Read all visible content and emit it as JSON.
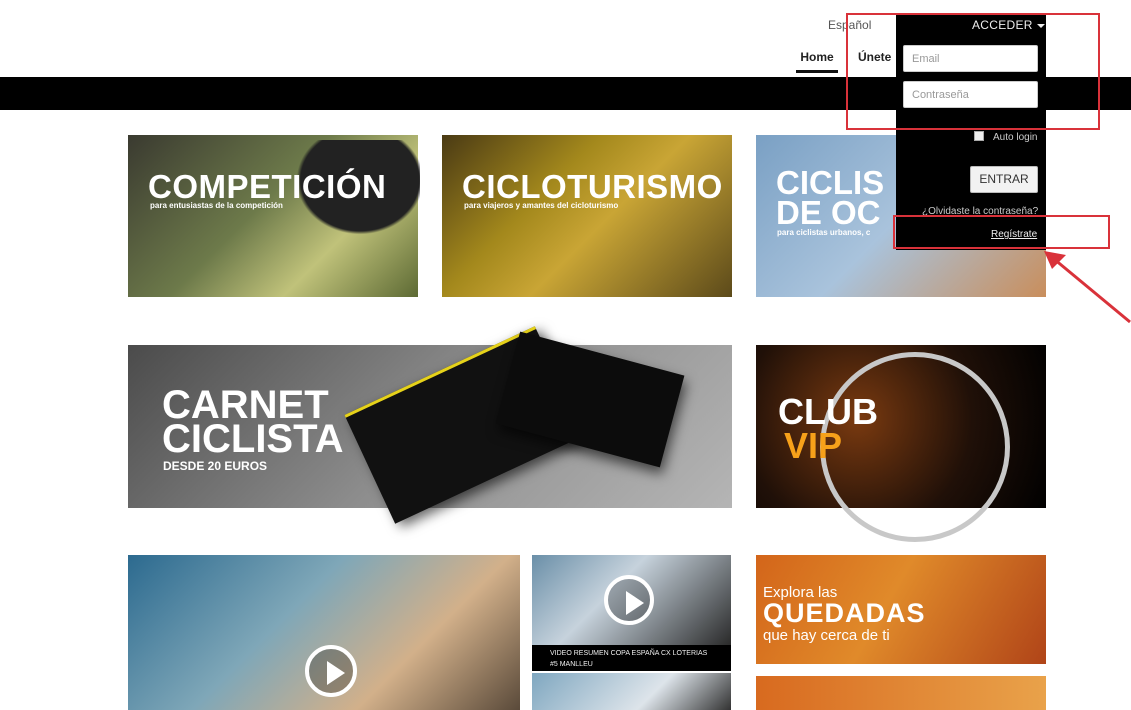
{
  "header": {
    "language": "Español",
    "nav": {
      "home": "Home",
      "unete": "Únete"
    }
  },
  "login": {
    "title": "ACCEDER",
    "email_placeholder": "Email",
    "password_placeholder": "Contraseña",
    "auto_login": "Auto login",
    "submit": "ENTRAR",
    "forgot": "¿Olvidaste la contraseña?",
    "register": "Regístrate"
  },
  "tiles": {
    "competicion": {
      "title": "COMPETICIÓN",
      "subtitle": "para entusiastas de la competición"
    },
    "cicloturismo": {
      "title": "CICLOTURISMO",
      "subtitle": "para viajeros y amantes del cicloturismo"
    },
    "ocio": {
      "line1": "CICLIS",
      "line2": "DE OC",
      "subtitle": "para ciclistas urbanos, c"
    },
    "carnet": {
      "line1": "CARNET",
      "line2": "CICLISTA",
      "subtitle": "DESDE 20 EUROS"
    },
    "club": {
      "line1": "CLUB",
      "line2": "VIP"
    },
    "video2": {
      "caption": "VIDEO RESUMEN COPA ESPAÑA CX LOTERIAS #5 MANLLEU"
    },
    "quedadas": {
      "line1": "Explora las",
      "line2": "QUEDADAS",
      "line3": "que hay cerca de ti"
    }
  },
  "colors": {
    "annotation_red": "#d9323a",
    "club_vip_orange": "#f7a11a",
    "nav_bar": "#000000"
  }
}
